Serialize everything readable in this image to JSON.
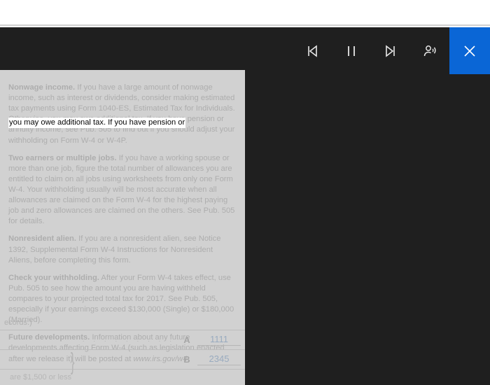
{
  "toolbar": {
    "prev": "previous",
    "pause": "pause",
    "next": "next",
    "voice": "voice-settings",
    "close": "close"
  },
  "highlight": "you may owe additional tax. If you have pension or",
  "doc": {
    "p1": {
      "b": "Nonwage income.",
      "t": " If you have a large amount of nonwage income, such as interest or dividends, consider making estimated tax payments using Form 1040-ES, Estimated Tax for Individuals. Otherwise, you may owe additional tax. If you have pension or annuity income, see Pub. 505 to find out if you should adjust your withholding on Form W-4 or W-4P."
    },
    "p2": {
      "b": "Two earners or multiple jobs.",
      "t": " If you have a working spouse or more than one job, figure the total number of allowances you are entitled to claim on all jobs using worksheets from only one Form W-4. Your withholding usually will be most accurate when all allowances are claimed on the Form W-4 for the highest paying job and zero allowances are claimed on the others. See Pub. 505 for details."
    },
    "p3": {
      "b": "Nonresident alien.",
      "t": " If you are a nonresident alien, see Notice 1392, Supplemental Form W-4 Instructions for Nonresident Aliens, before completing this form."
    },
    "p4": {
      "b": "Check your withholding.",
      "t": " After your Form W-4 takes effect, use Pub. 505 to see how the amount you are having withheld compares to your projected total tax for 2017. See Pub. 505, especially if your earnings exceed $130,000 (Single) or $180,000 (Married)."
    },
    "p5": {
      "b": "Future developments.",
      "t1": " Information about any future developments affecting Form W-4 (such as legislation enacted after we release it) will be posted at ",
      "i": "www.irs.gov/w4",
      "t2": "."
    }
  },
  "form": {
    "topnote": "ecords.)",
    "rowA": {
      "dots": ". . . . . . . . .",
      "letter": "A",
      "value": "1111"
    },
    "rowB": {
      "dots": ". . .",
      "letter": "B",
      "value": "2345"
    },
    "hint": "are $1,500 or less"
  }
}
